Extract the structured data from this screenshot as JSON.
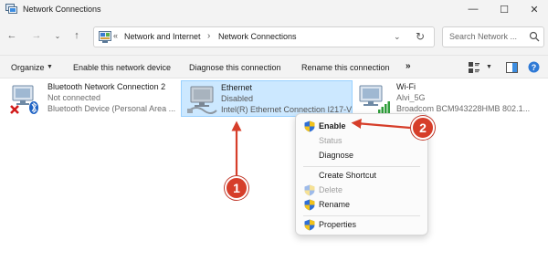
{
  "window": {
    "title": "Network Connections",
    "minimize_glyph": "—",
    "maximize_glyph": "☐",
    "close_glyph": "✕"
  },
  "nav": {
    "back_glyph": "←",
    "forward_glyph": "→",
    "recent_glyph": "⌄",
    "up_glyph": "↑"
  },
  "address": {
    "separator": "«",
    "crumbs": [
      "Network and Internet",
      "Network Connections"
    ],
    "chevron": "›",
    "dropdown_glyph": "⌄",
    "refresh_glyph": "↻"
  },
  "search": {
    "placeholder": "Search Network ..."
  },
  "commands": {
    "organize": "Organize",
    "organize_caret": "▼",
    "enable": "Enable this network device",
    "diagnose": "Diagnose this connection",
    "rename": "Rename this connection",
    "more": "»",
    "view_caret": "▼"
  },
  "items": [
    {
      "name": "Bluetooth Network Connection 2",
      "status": "Not connected",
      "device": "Bluetooth Device (Personal Area ..."
    },
    {
      "name": "Ethernet",
      "status": "Disabled",
      "device": "Intel(R) Ethernet Connection I217-V"
    },
    {
      "name": "Wi-Fi",
      "status": "Alvi_5G",
      "device": "Broadcom BCM943228HMB 802.1..."
    }
  ],
  "context_menu": {
    "enable": "Enable",
    "status": "Status",
    "diagnose": "Diagnose",
    "create_shortcut": "Create Shortcut",
    "delete": "Delete",
    "rename": "Rename",
    "properties": "Properties"
  },
  "annotations": {
    "step1": "1",
    "step2": "2"
  },
  "colors": {
    "annotation_red": "#d63e2a",
    "selection_fill": "#cce8ff",
    "selection_border": "#99d1ff",
    "chrome_bg": "#f3f3f3"
  },
  "icons": {
    "title": "network-connections-icon",
    "address": "control-panel-icon",
    "search": "search-icon",
    "view": "view-options-icon",
    "pane": "preview-pane-icon",
    "help": "help-icon",
    "bluetooth": "bluetooth-adapter-icon",
    "ethernet": "ethernet-adapter-icon",
    "wifi": "wifi-adapter-icon",
    "shield": "uac-shield-icon"
  }
}
